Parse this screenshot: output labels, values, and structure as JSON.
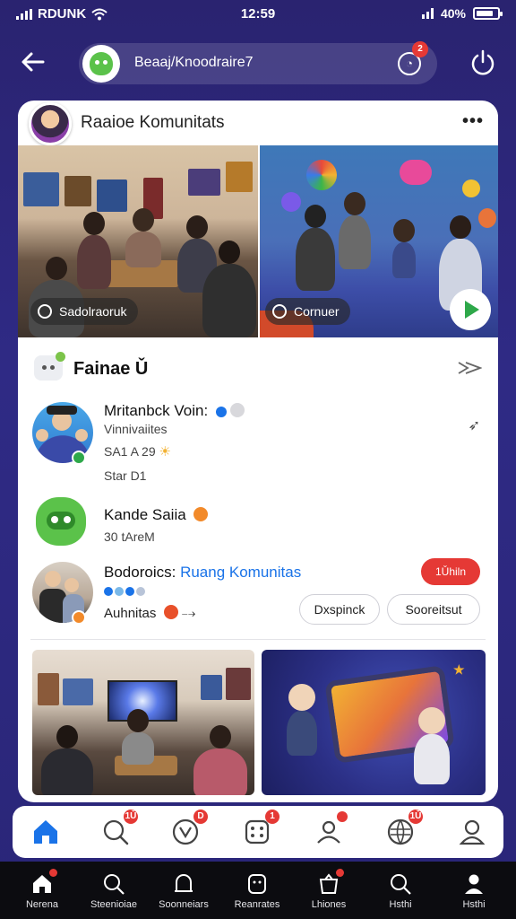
{
  "status_bar": {
    "carrier": "RDUNK",
    "time": "12:59",
    "battery": "40%"
  },
  "header": {
    "search_text": "Beaaj/Knoodraire7",
    "notification_count": "2"
  },
  "card": {
    "title": "Raaioe Komunitats",
    "more": "•••",
    "hero_left_chip": "Sadolraoruk",
    "hero_right_chip": "Cornuer"
  },
  "section": {
    "title": "Fainae Ǔ",
    "rows": [
      {
        "name": "Mritanbck Voin:",
        "line1": "Vinnivaiites",
        "line2": "SA1 A 29",
        "line3": "Star D1"
      },
      {
        "name": "Kande Saiia",
        "line1": "30 tAreM"
      },
      {
        "name": "Bodoroics:",
        "name_accent": "Ruang Komunitas",
        "line1": "Auhnitas",
        "badge": "1Ǔhiln",
        "btn_primary": "Dxspinck",
        "btn_secondary": "Sooreitsut"
      }
    ]
  },
  "tabbar": {
    "badges": [
      "1Ǔ",
      "D",
      "1",
      "1Ǔ"
    ]
  },
  "system_nav": {
    "items": [
      "Nerena",
      "Steenioiae",
      "Soonneiars",
      "Reanrates",
      "Lhiones",
      "Hsthi"
    ]
  },
  "colors": {
    "accent_blue": "#1a73e8",
    "badge_red": "#e53935",
    "brand_green": "#5bc24a",
    "header_bg": "#2a2370"
  }
}
